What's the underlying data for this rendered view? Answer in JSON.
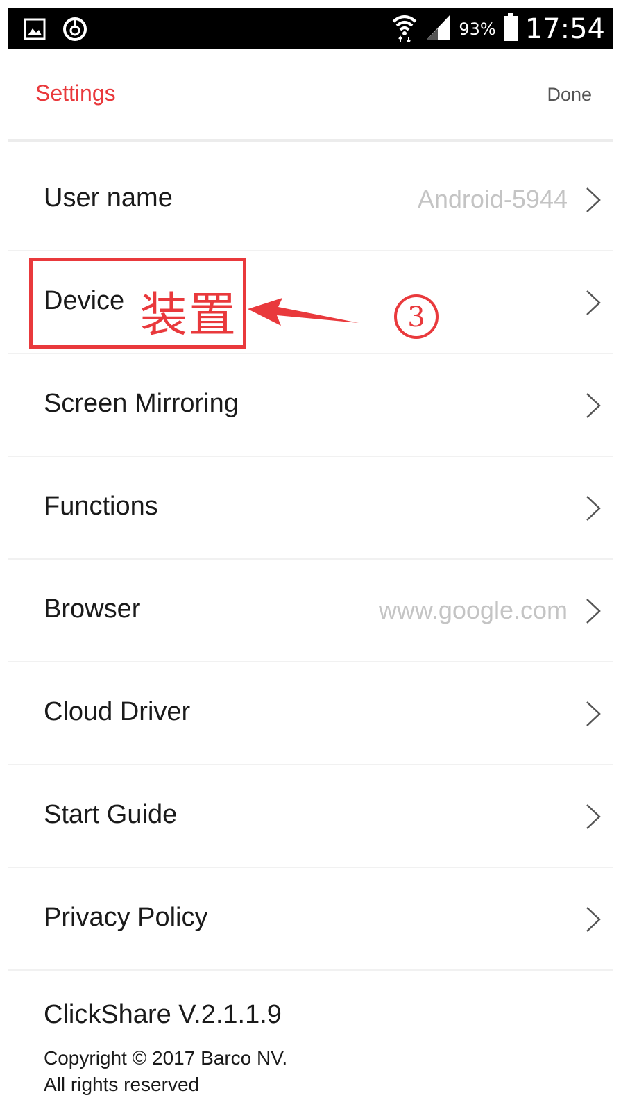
{
  "status_bar": {
    "battery_percent": "93%",
    "time": "17:54",
    "icons": [
      "gallery-icon",
      "sync-icon",
      "wifi-icon",
      "signal-icon",
      "battery-icon"
    ]
  },
  "header": {
    "title": "Settings",
    "done_label": "Done"
  },
  "rows": [
    {
      "label": "User name",
      "value": "Android-5944"
    },
    {
      "label": "Device",
      "value": ""
    },
    {
      "label": "Screen Mirroring",
      "value": ""
    },
    {
      "label": "Functions",
      "value": ""
    },
    {
      "label": "Browser",
      "value": "www.google.com"
    },
    {
      "label": "Cloud Driver",
      "value": ""
    },
    {
      "label": "Start Guide",
      "value": ""
    },
    {
      "label": "Privacy Policy",
      "value": ""
    }
  ],
  "annotation": {
    "cjk_text": "装置",
    "step_number": "3",
    "color": "#e9393c"
  },
  "footer": {
    "version": "ClickShare V.2.1.1.9",
    "copyright_line1": "Copyright © 2017 Barco NV.",
    "copyright_line2": "All rights reserved"
  },
  "colors": {
    "accent": "#e9393c",
    "value_gray": "#c4c4c4",
    "divider": "#f1f1f1"
  }
}
